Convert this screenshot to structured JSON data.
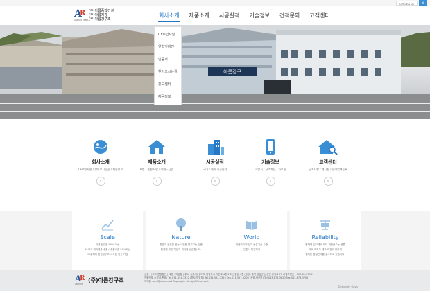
{
  "topbar": {
    "contact_label": "contact us",
    "home_icon": "home-icon"
  },
  "logo": {
    "mark_a": "A",
    "mark_r": "R",
    "mark_sub": "AREUM STEEL",
    "line1": "(주)아름종합건설",
    "line2": "(주)아름제강",
    "line3": "(주)아름강구조"
  },
  "nav": {
    "items": [
      "회사소개",
      "제품소개",
      "시공실적",
      "기술정보",
      "견적문의",
      "고객센터"
    ]
  },
  "dropdown": {
    "items": [
      "CEO인사말",
      "연혁및비전",
      "인증서",
      "찾아오시는길",
      "홍보센터",
      "채용정보"
    ]
  },
  "hero": {
    "sign_text": "아름강구"
  },
  "quick": [
    {
      "title": "회사소개",
      "desc": "CEO인사말 / 찾아오시는길 / 채용정보",
      "icon": "globe-icon"
    },
    {
      "title": "제품소개",
      "desc": "H빔 / 중형 H빔 / 아연도금빔",
      "icon": "house-icon"
    },
    {
      "title": "시공실적",
      "desc": "국내 / 해외 시공실적",
      "icon": "buildings-icon"
    },
    {
      "title": "기술정보",
      "desc": "시방서 / 구조계산 / 자료실",
      "icon": "phone-icon"
    },
    {
      "title": "고객센터",
      "desc": "공지사항 / 게시판 / 협력업체등록",
      "icon": "house-search-icon"
    }
  ],
  "quick_go": "›",
  "values": [
    {
      "title": "Scale",
      "desc": "국내 점유율 60% 이상\n12개국 해외제품 수출 / 수출비중 50%이상\n국내 최대 종합강구조 시스템 생산 기업",
      "icon": "graph-icon"
    },
    {
      "title": "Nature",
      "desc": "환경과 공존을 꿈는 사업을 펼치고는 인증\n환경에 대한 책임의 의식을 공감합니다.",
      "icon": "tree-icon"
    },
    {
      "title": "World",
      "desc": "제품의 우수성과 높은기술 수준\n인증서 확인하기",
      "icon": "book-icon"
    },
    {
      "title": "Reliability",
      "desc": "원자재 입고에서 부터 제품출고는 물론\n제고 과하도 제조 과정에 대하여\n철저한 품질관리를 실시하고 있습니다.",
      "icon": "scale-icon"
    }
  ],
  "footer": {
    "logo_name": "(주)아름강구조",
    "logo_sub": "AREUM",
    "info1": "상호 : (주)아름종합건 | 대표 : 박성철 | 주소 : (본사) 경기도 남양주시 가운로 4층 2 다산빌딩 4층 (공장) 충북 음성군 삼성면 상곡로 70 사업자번호 : 303-81-27987",
    "info2": "전화번호 : (본사-판매) Tel.031-554-3322 (본사-영업부) Tel.031-554-3323 Fax.031-557-3200 (공장-생산부) Tel.043-878-3620 Fax.043-878-3702",
    "info3": "이메일 : ardi@daum.net  Copyright. All right Reserved.",
    "brand": "Design by Oasis"
  }
}
